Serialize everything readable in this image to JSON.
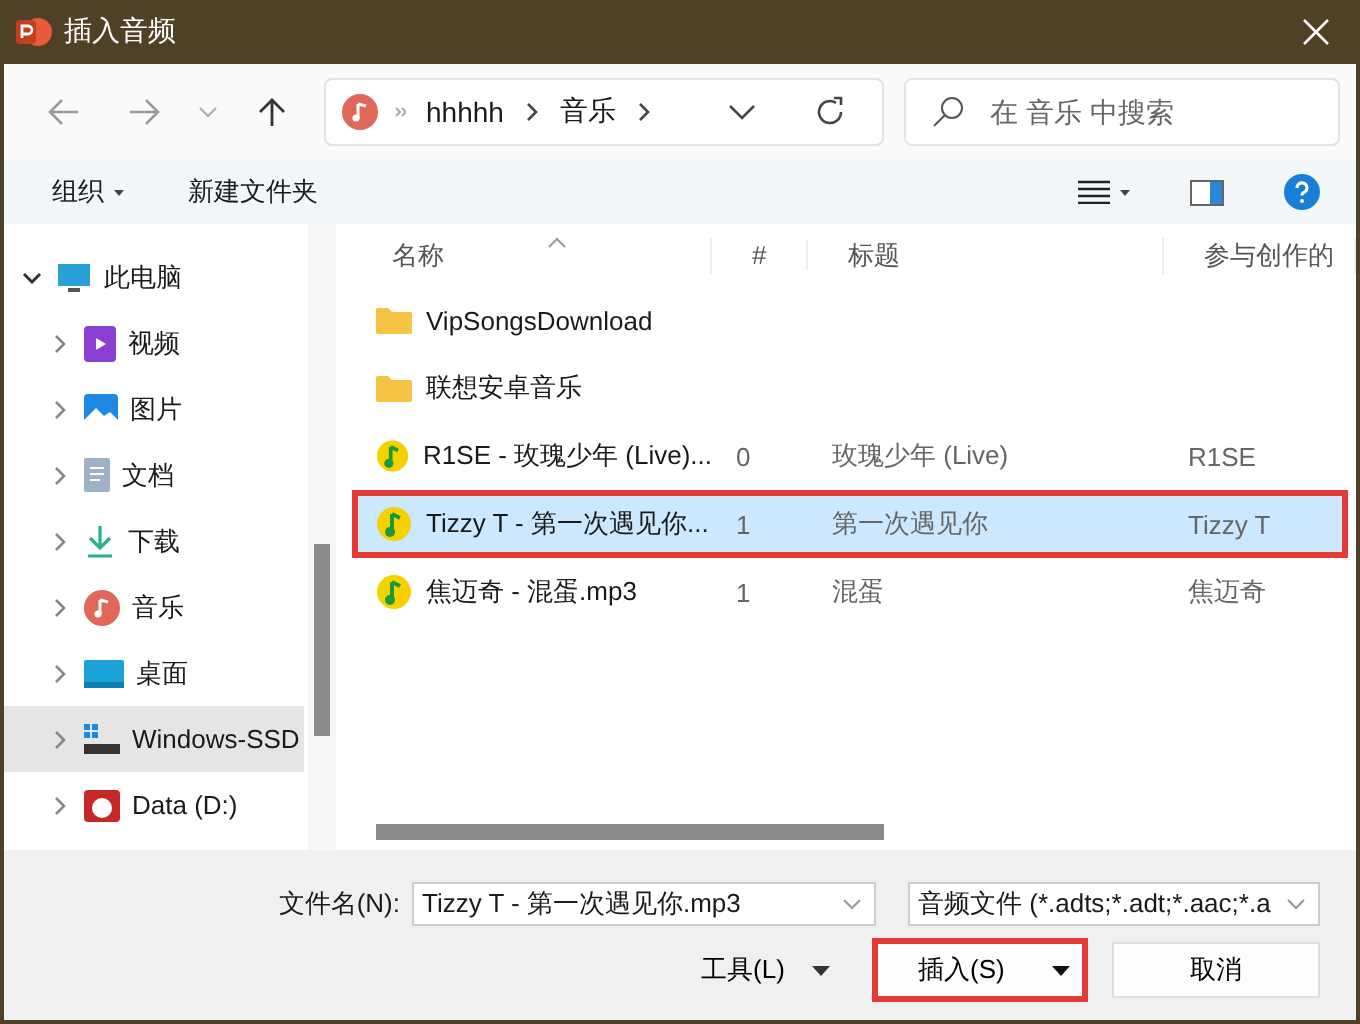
{
  "window": {
    "title": "插入音频"
  },
  "nav": {
    "path": [
      "hhhhh",
      "音乐"
    ],
    "search_placeholder": "在 音乐 中搜索"
  },
  "toolbar": {
    "organize": "组织",
    "new_folder": "新建文件夹"
  },
  "sidebar": {
    "items": [
      {
        "label": "此电脑",
        "kind": "computer",
        "expanded": true,
        "selected": false,
        "children": [
          {
            "label": "视频",
            "kind": "video",
            "expanded": false,
            "selected": false
          },
          {
            "label": "图片",
            "kind": "pictures",
            "expanded": false,
            "selected": false
          },
          {
            "label": "文档",
            "kind": "documents",
            "expanded": false,
            "selected": false
          },
          {
            "label": "下载",
            "kind": "downloads",
            "expanded": false,
            "selected": false
          },
          {
            "label": "音乐",
            "kind": "music",
            "expanded": false,
            "selected": false
          },
          {
            "label": "桌面",
            "kind": "desktop",
            "expanded": false,
            "selected": false
          },
          {
            "label": "Windows-SSD",
            "kind": "system-drive",
            "expanded": false,
            "selected": true
          },
          {
            "label": "Data (D:)",
            "kind": "drive",
            "expanded": false,
            "selected": false
          }
        ]
      }
    ]
  },
  "file_list": {
    "columns": [
      "名称",
      "#",
      "标题",
      "参与创作的"
    ],
    "rows": [
      {
        "kind": "folder",
        "name": "VipSongsDownload",
        "selected": false,
        "highlighted": false
      },
      {
        "kind": "folder",
        "name": "联想安卓音乐",
        "selected": false,
        "highlighted": false
      },
      {
        "kind": "audio",
        "name": "R1SE - 玫瑰少年 (Live)...",
        "number": "0",
        "title": "玫瑰少年 (Live)",
        "artist": "R1SE",
        "selected": false,
        "highlighted": false
      },
      {
        "kind": "audio",
        "name": "Tizzy T - 第一次遇见你...",
        "number": "1",
        "title": "第一次遇见你",
        "artist": "Tizzy T",
        "selected": true,
        "highlighted": true
      },
      {
        "kind": "audio",
        "name": "焦迈奇 - 混蛋.mp3",
        "number": "1",
        "title": "混蛋",
        "artist": "焦迈奇",
        "selected": false,
        "highlighted": false
      }
    ]
  },
  "footer": {
    "filename_label": "文件名(N):",
    "filename": "Tizzy T - 第一次遇见你.mp3",
    "filter": "音频文件 (*.adts;*.adt;*.aac;*.a",
    "tools": "工具(L)",
    "insert": {
      "label": "插入(S)",
      "highlighted": true
    },
    "cancel": "取消"
  }
}
